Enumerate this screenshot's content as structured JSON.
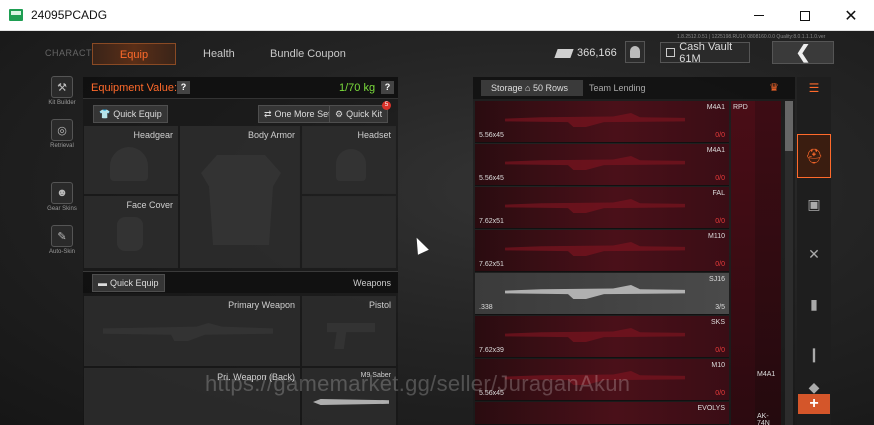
{
  "window": {
    "title": "24095PCADG"
  },
  "header": {
    "section": "CHARACTER",
    "tabs": [
      {
        "label": "Equip",
        "active": true
      },
      {
        "label": "Health",
        "active": false
      },
      {
        "label": "Bundle Coupon",
        "active": false
      }
    ],
    "currency_amount": "366,166",
    "cash_vault": "Cash Vault 61M",
    "hud_text": "1.8.2512.0.51 | 1225198.RU1X  0808160.0.0  Quality:8.0.1.1.1.0.ver"
  },
  "left_sidebar": [
    {
      "label": "Kit Builder",
      "icon": "kit-builder-icon",
      "glyph": "⚒"
    },
    {
      "label": "Retrieval",
      "icon": "retrieval-icon",
      "glyph": "◎"
    },
    {
      "label": "Gear Skins",
      "icon": "gear-skins-icon",
      "glyph": "☻"
    },
    {
      "label": "Auto-Skin",
      "icon": "auto-skin-icon",
      "glyph": "✎"
    }
  ],
  "equipment": {
    "value_label": "Equipment Value: 0",
    "weight": "1/70 kg",
    "quick_equip": "Quick Equip",
    "one_more_set": "One More Set",
    "quick_kit": "Quick Kit",
    "quick_kit_badge": "5",
    "slots": {
      "headgear": "Headgear",
      "body_armor": "Body Armor",
      "headset": "Headset",
      "face_cover": "Face Cover"
    },
    "weapons_label": "Weapons",
    "weapon_quick_equip": "Quick Equip",
    "weapon_slots": {
      "primary": "Primary Weapon",
      "pistol": "Pistol",
      "primary_back": "Pri. Weapon (Back)",
      "melee": "M9 Saber"
    }
  },
  "storage": {
    "tab_storage": "Storage",
    "rows_label": "50 Rows",
    "tab_team": "Team Lending",
    "items": [
      {
        "name": "M4A1",
        "ammo": "5.56x45",
        "count": "0/0"
      },
      {
        "name": "M4A1",
        "ammo": "5.56x45",
        "count": "0/0"
      },
      {
        "name": "FAL",
        "ammo": "7.62x51",
        "count": "0/0"
      },
      {
        "name": "M110",
        "ammo": "7.62x51",
        "count": "0/0"
      },
      {
        "name": "SJ16",
        "ammo": ".338",
        "count": "3/5"
      },
      {
        "name": "SKS",
        "ammo": "7.62x39",
        "count": "0/0"
      },
      {
        "name": "M10",
        "ammo": "5.56x45",
        "count": "0/0"
      }
    ],
    "side_items": [
      {
        "name": "RPD"
      },
      {
        "name": "M4A1"
      },
      {
        "name": "AK-74N"
      }
    ],
    "bottom_label": "EVOLYS"
  },
  "watermark": "https://gamemarket.gg/seller/JuraganAkun",
  "colors": {
    "accent": "#ff6a2b",
    "weight_green": "#7bdc3c",
    "storage_red": "#4a1019"
  }
}
